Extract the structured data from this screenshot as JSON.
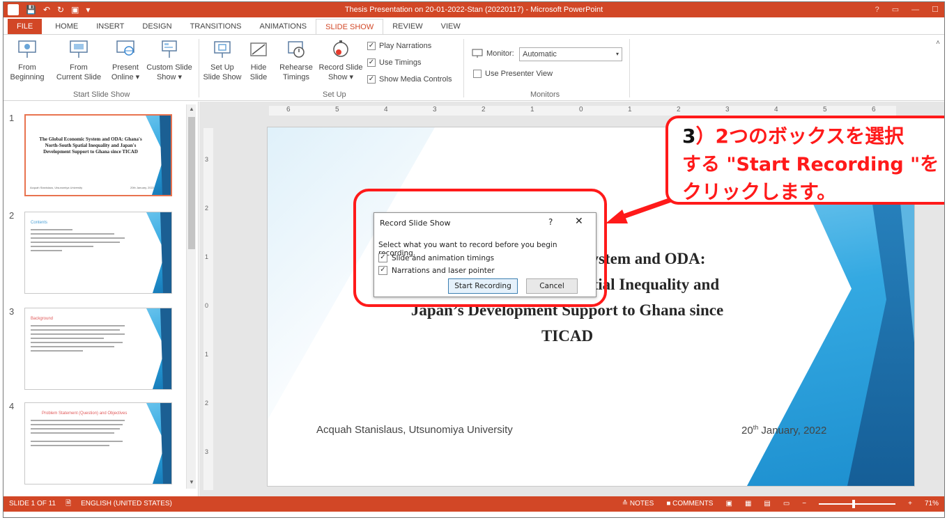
{
  "window": {
    "title": "Thesis Presentation on 20-01-2022-Stan (20220117) -  Microsoft PowerPoint",
    "app_icon": "P",
    "accent": "#d24726"
  },
  "tabs": [
    "FILE",
    "HOME",
    "INSERT",
    "DESIGN",
    "TRANSITIONS",
    "ANIMATIONS",
    "SLIDE SHOW",
    "REVIEW",
    "VIEW"
  ],
  "ribbon": {
    "from_beginning": "From\nBeginning",
    "from_current": "From\nCurrent Slide",
    "present_online": "Present\nOnline ▾",
    "custom_slide_show": "Custom Slide\nShow ▾",
    "group_start": "Start Slide Show",
    "set_up_slide_show": "Set Up\nSlide Show",
    "hide_slide": "Hide\nSlide",
    "rehearse_timings": "Rehearse\nTimings",
    "record_slide_show": "Record Slide\nShow ▾",
    "play_narrations": "Play Narrations",
    "use_timings": "Use Timings",
    "show_media_controls": "Show Media Controls",
    "group_setup": "Set Up",
    "monitor_label": "Monitor:",
    "monitor_value": "Automatic",
    "use_presenter_view": "Use Presenter View",
    "group_monitors": "Monitors"
  },
  "thumbnails": [
    {
      "num": "1",
      "title": "The Global Economic System and ODA: Ghana's North-South Spatial Inequality and Japan's Development Support to Ghana since TICAD",
      "footer_left": "Acquah Stanislaus, Utsunomiya University",
      "footer_right": "20th January, 2022"
    },
    {
      "num": "2",
      "heading": "Contents"
    },
    {
      "num": "3",
      "heading": "Background"
    },
    {
      "num": "4",
      "heading": "Problem Statement (Question) and Objectives"
    }
  ],
  "ruler": {
    "h_ticks": [
      "6",
      "5",
      "4",
      "3",
      "2",
      "1",
      "0",
      "1",
      "2",
      "3",
      "4",
      "5",
      "6"
    ],
    "v_ticks": [
      "3",
      "2",
      "1",
      "0",
      "1",
      "2",
      "3"
    ]
  },
  "slide": {
    "title_line1": "The Global Economic System and ODA:",
    "title_line2": "Ghana’s North-South Spatial Inequality and",
    "title_line3": "Japan’s Development Support to Ghana since",
    "title_line4": "TICAD",
    "author": "Acquah Stanislaus, Utsunomiya University",
    "date_day": "20",
    "date_sup": "th",
    "date_rest": " January, 2022"
  },
  "dialog": {
    "title": "Record Slide Show",
    "help": "?",
    "close": "✕",
    "prompt": "Select what you want to record before you begin recording.",
    "opt1": "Slide and animation timings",
    "opt2": "Narrations and laser pointer",
    "opt1_checked": true,
    "opt2_checked": true,
    "start": "Start Recording",
    "cancel": "Cancel"
  },
  "annotation": {
    "step": "3",
    "line1": "）2つのボックスを選択",
    "line2": "する \"Start Recording \"を",
    "line3": "クリックします。",
    "color": "#ff1a1a"
  },
  "status": {
    "slide_count": "SLIDE 1 OF 11",
    "language": "ENGLISH (UNITED STATES)",
    "notes": "≙ NOTES",
    "comments": "COMMENTS",
    "zoom": "71%",
    "zoom_level": 0.71
  }
}
